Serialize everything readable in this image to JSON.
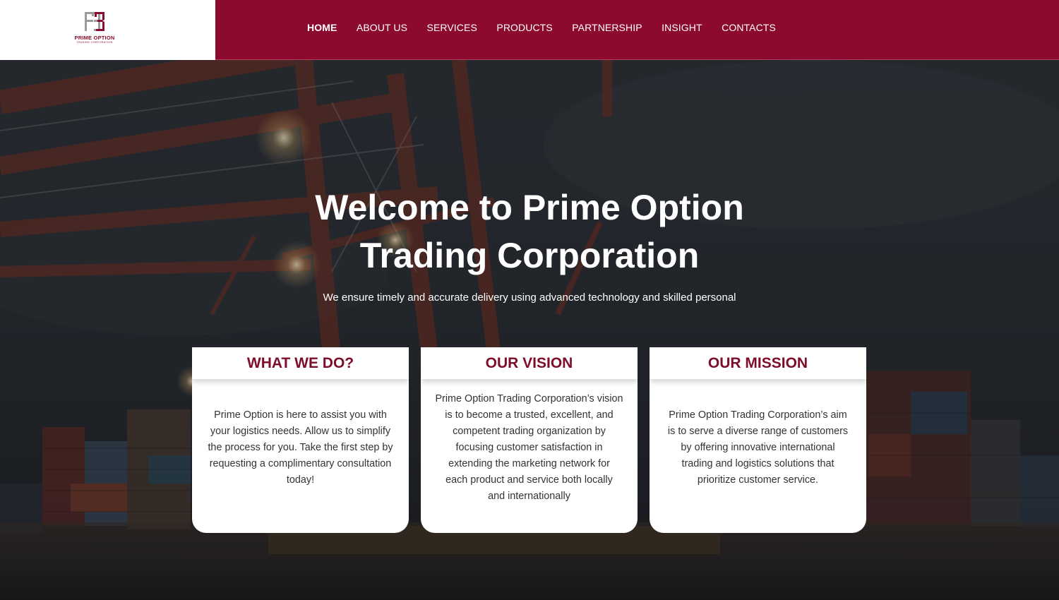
{
  "brand": {
    "name": "PRIME OPTION",
    "tagline": "TRADING CORPORATION",
    "color": "#8b0a2d"
  },
  "nav": {
    "items": [
      {
        "label": "HOME",
        "active": true
      },
      {
        "label": "ABOUT US"
      },
      {
        "label": "SERVICES"
      },
      {
        "label": "PRODUCTS"
      },
      {
        "label": "PARTNERSHIP"
      },
      {
        "label": "INSIGHT"
      },
      {
        "label": "CONTACTS"
      }
    ]
  },
  "hero": {
    "title_line1": "Welcome to Prime Option",
    "title_line2": "Trading Corporation",
    "subtitle": "We ensure timely and accurate delivery using advanced technology and skilled personal"
  },
  "cards": [
    {
      "title": "WHAT WE DO?",
      "lines": [
        "Prime Option is here to assist you with",
        "your logistics needs. Allow us to simplify",
        "the process for you. Take the first step by",
        "requesting a complimentary consultation",
        "today!"
      ]
    },
    {
      "title": "OUR VISION",
      "lines": [
        "Prime Option Trading Corporation’s vision",
        "is to become a trusted, excellent, and",
        "competent trading organization by",
        "focusing customer satisfaction in",
        "extending the marketing network for",
        "each product and service both locally",
        "and internationally"
      ]
    },
    {
      "title": "OUR MISSION",
      "lines": [
        "Prime Option Trading Corporation’s aim",
        "is to serve a diverse range of customers",
        "by offering innovative international",
        "trading and logistics solutions that",
        "prioritize customer service."
      ]
    }
  ]
}
